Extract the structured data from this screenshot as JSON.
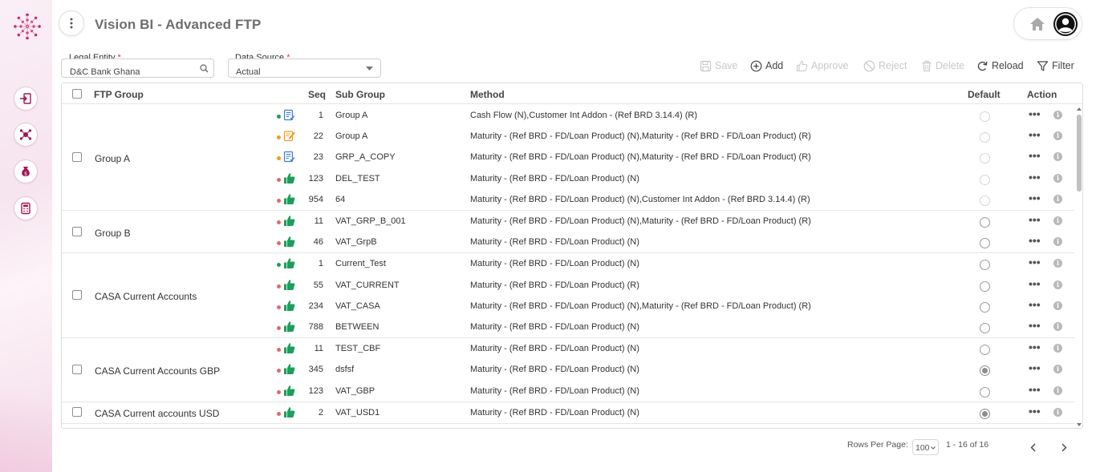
{
  "app": {
    "title": "Vision BI - Advanced FTP"
  },
  "filters": {
    "legal_entity": {
      "label": "Legal Entity",
      "required_mark": "*",
      "value": "D&C Bank Ghana"
    },
    "data_source": {
      "label": "Data Source",
      "required_mark": "*",
      "value": "Actual"
    }
  },
  "toolbar": {
    "save": "Save",
    "add": "Add",
    "approve": "Approve",
    "reject": "Reject",
    "delete": "Delete",
    "reload": "Reload",
    "filter": "Filter"
  },
  "table": {
    "columns": {
      "ftp_group": "FTP Group",
      "seq": "Seq",
      "sub_group": "Sub Group",
      "method": "Method",
      "default": "Default",
      "action": "Action"
    },
    "groups": [
      {
        "name": "Group A",
        "rows": [
          {
            "status_dot": "#1e9e5b",
            "status_icon": "doc",
            "seq": "1",
            "sub_group": "Group A",
            "method": "Cash Flow (N),Customer Int Addon - (Ref BRD 3.14.4) (R)",
            "default": "faded"
          },
          {
            "status_dot": "#f29b1e",
            "status_icon": "edit",
            "seq": "22",
            "sub_group": "Group A",
            "method": "Maturity - (Ref BRD - FD/Loan Product) (N),Maturity - (Ref BRD - FD/Loan Product) (R)",
            "default": "faded"
          },
          {
            "status_dot": "#f29b1e",
            "status_icon": "doc",
            "seq": "23",
            "sub_group": "GRP_A_COPY",
            "method": "Maturity - (Ref BRD - FD/Loan Product) (N),Maturity - (Ref BRD - FD/Loan Product) (R)",
            "default": "faded"
          },
          {
            "status_dot": "#e06a6a",
            "status_icon": "thumb",
            "seq": "123",
            "sub_group": "DEL_TEST",
            "method": "Maturity - (Ref BRD - FD/Loan Product) (N)",
            "default": "faded"
          },
          {
            "status_dot": "#e06a6a",
            "status_icon": "thumb",
            "seq": "954",
            "sub_group": "64",
            "method": "Maturity - (Ref BRD - FD/Loan Product) (N),Customer Int Addon - (Ref BRD 3.14.4) (R)",
            "default": "faded"
          }
        ]
      },
      {
        "name": "Group B",
        "rows": [
          {
            "status_dot": "#e06a6a",
            "status_icon": "thumb",
            "seq": "11",
            "sub_group": "VAT_GRP_B_001",
            "method": "Maturity - (Ref BRD - FD/Loan Product) (N),Maturity - (Ref BRD - FD/Loan Product) (R)",
            "default": "off"
          },
          {
            "status_dot": "#e06a6a",
            "status_icon": "thumb",
            "seq": "46",
            "sub_group": "VAT_GrpB",
            "method": "Maturity - (Ref BRD - FD/Loan Product) (N)",
            "default": "off"
          }
        ]
      },
      {
        "name": "CASA Current Accounts",
        "rows": [
          {
            "status_dot": "#1e9e5b",
            "status_icon": "thumb",
            "seq": "1",
            "sub_group": "Current_Test",
            "method": "Maturity - (Ref BRD - FD/Loan Product) (N)",
            "default": "off"
          },
          {
            "status_dot": "#e06a6a",
            "status_icon": "thumb",
            "seq": "55",
            "sub_group": "VAT_CURRENT",
            "method": "Maturity - (Ref BRD - FD/Loan Product) (R)",
            "default": "off"
          },
          {
            "status_dot": "#e06a6a",
            "status_icon": "thumb",
            "seq": "234",
            "sub_group": "VAT_CASA",
            "method": "Maturity - (Ref BRD - FD/Loan Product) (N),Maturity - (Ref BRD - FD/Loan Product) (R)",
            "default": "off"
          },
          {
            "status_dot": "#e06a6a",
            "status_icon": "thumb",
            "seq": "788",
            "sub_group": "BETWEEN",
            "method": "Maturity - (Ref BRD - FD/Loan Product) (N)",
            "default": "off"
          }
        ]
      },
      {
        "name": "CASA Current Accounts GBP",
        "rows": [
          {
            "status_dot": "#e06a6a",
            "status_icon": "thumb",
            "seq": "11",
            "sub_group": "TEST_CBF",
            "method": "Maturity - (Ref BRD - FD/Loan Product) (N)",
            "default": "off"
          },
          {
            "status_dot": "#e06a6a",
            "status_icon": "thumb",
            "seq": "345",
            "sub_group": "dsfsf",
            "method": "Maturity - (Ref BRD - FD/Loan Product) (N)",
            "default": "on"
          },
          {
            "status_dot": "#e06a6a",
            "status_icon": "thumb",
            "seq": "123",
            "sub_group": "VAT_GBP",
            "method": "Maturity - (Ref BRD - FD/Loan Product) (N)",
            "default": "off"
          }
        ]
      },
      {
        "name": "CASA Current accounts USD",
        "rows": [
          {
            "status_dot": "#e06a6a",
            "status_icon": "thumb",
            "seq": "2",
            "sub_group": "VAT_USD1",
            "method": "Maturity - (Ref BRD - FD/Loan Product) (N)",
            "default": "on"
          }
        ]
      }
    ]
  },
  "pagination": {
    "rows_per_page_label": "Rows Per Page:",
    "rows_per_page": "100",
    "range": "1 - 16 of 16"
  },
  "colors": {
    "accent_pink": "#c2185b",
    "thumb_green": "#1e9e5b",
    "edit_orange": "#f29b1e",
    "doc_blue": "#3a7bd5"
  }
}
